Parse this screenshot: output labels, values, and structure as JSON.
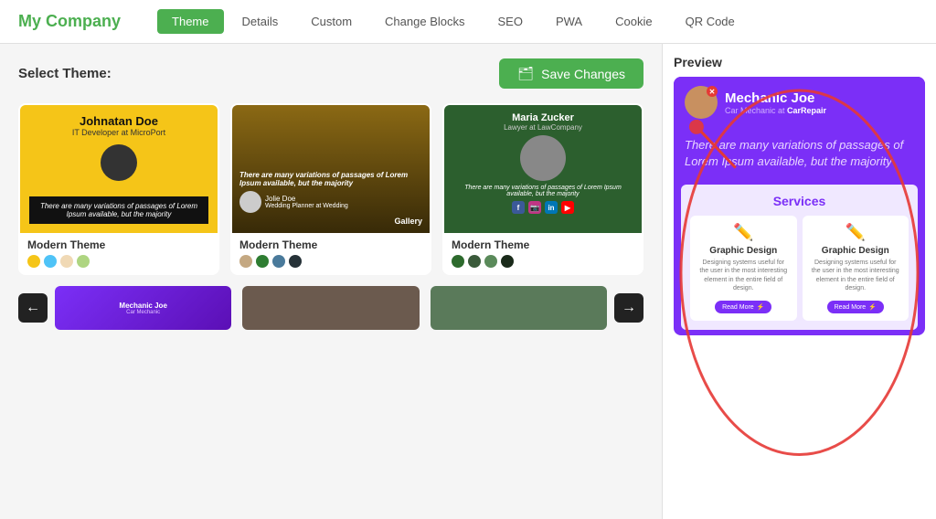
{
  "header": {
    "logo": "My Company",
    "nav": {
      "tabs": [
        {
          "label": "Theme",
          "active": true
        },
        {
          "label": "Details",
          "active": false
        },
        {
          "label": "Custom",
          "active": false
        },
        {
          "label": "Change Blocks",
          "active": false
        },
        {
          "label": "SEO",
          "active": false
        },
        {
          "label": "PWA",
          "active": false
        },
        {
          "label": "Cookie",
          "active": false
        },
        {
          "label": "QR Code",
          "active": false
        }
      ]
    }
  },
  "left": {
    "select_label": "Select Theme:",
    "save_btn": "Save Changes",
    "themes": [
      {
        "name": "Modern Theme",
        "person": "Johnatan Doe",
        "subtitle": "IT Developer at MicroPort",
        "body_text": "There are many variations of passages of Lorem Ipsum available, but the majority",
        "colors": [
          "#f5c518",
          "#4fc3f7",
          "#f0d9b5",
          "#aed581"
        ],
        "style": "yellow"
      },
      {
        "name": "Modern Theme",
        "person": "Jolie Doe",
        "subtitle": "Wedding Planner at Wedding",
        "body_text": "There are many variations of passages of Lorem Ipsum available, but the majority",
        "colors": [
          "#c4a882",
          "#2e7d32",
          "#4a7a9b",
          "#263238"
        ],
        "style": "gallery",
        "label": "Gallery"
      },
      {
        "name": "Modern Theme",
        "person": "Maria Zucker",
        "subtitle": "Lawyer at LawCompany",
        "body_text": "There are many variations of passages of Lorem Ipsum available, but the majority",
        "colors": [
          "#2d6a2d",
          "#3a5a3a",
          "#5a8a5a",
          "#1a2a1a"
        ],
        "style": "lawyer"
      }
    ]
  },
  "preview": {
    "label": "Preview",
    "person_name": "Mechanic Joe",
    "person_role": "Car Mechanic at ",
    "person_company": "CarRepair",
    "tagline": "There are many variations of passages of Lorem Ipsum available, but the majority",
    "services_title": "Services",
    "services": [
      {
        "name": "Graphic Design",
        "desc": "Designing systems useful for the user in the most interesting element in the entire field of design.",
        "btn": "Read More"
      },
      {
        "name": "Graphic Design",
        "desc": "Designing systems useful for the user in the most interesting element in the entire field of design.",
        "btn": "Read More"
      }
    ]
  },
  "bottom_thumbnails": [
    {
      "style": "purple",
      "name": "Mechanic Joe"
    },
    {
      "style": "brown"
    },
    {
      "style": "green"
    }
  ],
  "arrows": {
    "left": "←",
    "right": "→"
  }
}
